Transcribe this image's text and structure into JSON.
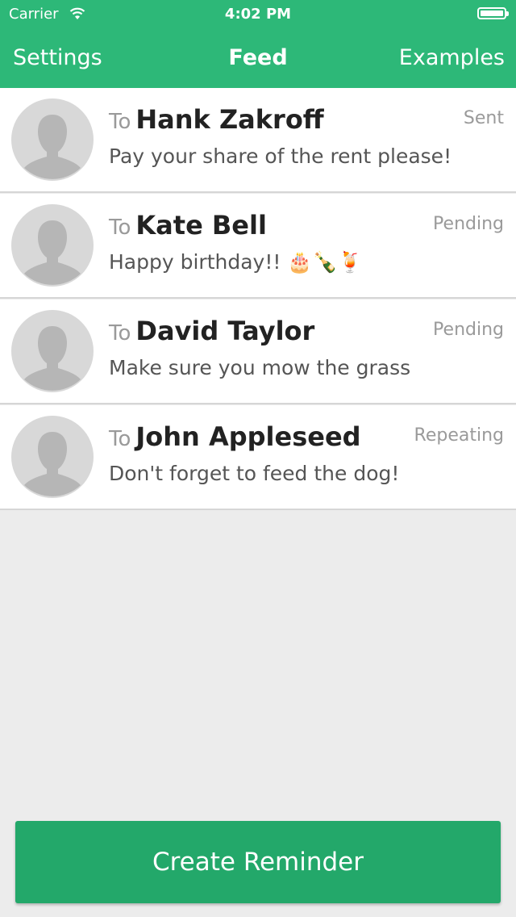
{
  "status_bar": {
    "carrier": "Carrier",
    "time": "4:02 PM"
  },
  "nav": {
    "left": "Settings",
    "title": "Feed",
    "right": "Examples"
  },
  "to_label": "To",
  "reminders": [
    {
      "name": "Hank Zakroff",
      "status": "Sent",
      "message": "Pay your share of the rent please!"
    },
    {
      "name": "Kate Bell",
      "status": "Pending",
      "message": "Happy birthday!! 🎂🍾🍹"
    },
    {
      "name": "David Taylor",
      "status": "Pending",
      "message": "Make sure you mow the grass"
    },
    {
      "name": "John Appleseed",
      "status": "Repeating",
      "message": "Don't forget to feed the dog!"
    }
  ],
  "create_button": "Create Reminder",
  "colors": {
    "accent": "#2db878",
    "button": "#23a86a",
    "background": "#ececec"
  }
}
